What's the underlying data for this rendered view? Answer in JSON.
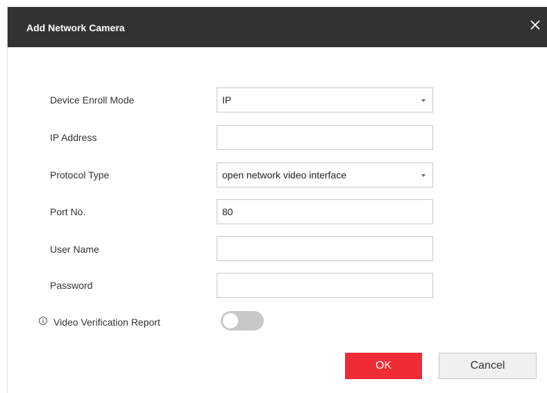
{
  "dialog": {
    "title": "Add Network Camera",
    "close_icon": "close-icon"
  },
  "form": {
    "enroll_mode": {
      "label": "Device Enroll Mode",
      "value": "IP"
    },
    "ip_address": {
      "label": "IP Address",
      "value": ""
    },
    "protocol": {
      "label": "Protocol Type",
      "value": "open network video interface"
    },
    "port": {
      "label": "Port No.",
      "value": "80"
    },
    "user_name": {
      "label": "User Name",
      "value": ""
    },
    "password": {
      "label": "Password",
      "value": ""
    },
    "video_verification": {
      "label": "Video Verification Report",
      "enabled": false,
      "icon": "info-icon"
    }
  },
  "buttons": {
    "ok": "OK",
    "cancel": "Cancel"
  },
  "colors": {
    "header_bg": "#333333",
    "ok_bg": "#ef2b36",
    "toggle_off": "#c8c8c8"
  }
}
